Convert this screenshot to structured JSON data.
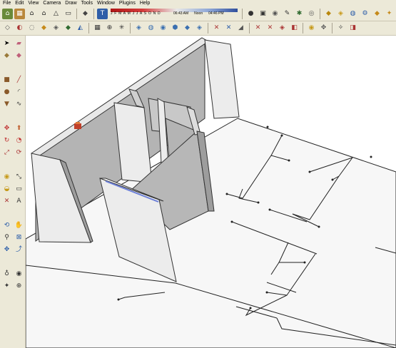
{
  "menu": [
    "File",
    "Edit",
    "View",
    "Camera",
    "Draw",
    "Tools",
    "Window",
    "Plugins",
    "Help"
  ],
  "shadow_settings": {
    "months": "J F M A M J J A S O N D",
    "time_start": "06:43 AM",
    "time_noon": "Noon",
    "time_end": "04:46 PM"
  },
  "icons": {
    "row1_a": [
      "footprint-icon",
      "components-icon",
      "home-icon",
      "house-icon",
      "house-outline-icon",
      "scene-icon"
    ],
    "row1_b": [
      "styles-icon",
      "text-icon"
    ],
    "row1_c": [
      "cup-icon",
      "warehouse-icon",
      "sphere-icon",
      "pen-icon",
      "bug-icon",
      "layers-icon"
    ],
    "row1_d": [
      "rocket-icon",
      "cube-icon",
      "globe-icon",
      "gear-icon",
      "tag-icon",
      "sparkle-icon"
    ],
    "row2": [
      "box-icon",
      "push-pull-icon",
      "follow-icon",
      "paint-icon",
      "explode-icon",
      "sandbox-icon",
      "section-icon",
      "grid-icon",
      "crosshair-icon",
      "sun-icon",
      "iso-view-icon",
      "top-view-icon",
      "front-view-icon",
      "right-view-icon",
      "back-view-icon",
      "left-view-icon",
      "xray-icon",
      "back-edges-icon",
      "wire-icon",
      "hidden-line-icon",
      "shaded-icon",
      "textured-icon",
      "mono-icon",
      "camera-icon",
      "look-icon",
      "walk-icon",
      "position-icon"
    ],
    "left": [
      "select-tool-icon",
      "eraser-tool-icon",
      "component-tool-icon",
      "paint-bucket-icon",
      "rectangle-tool-icon",
      "line-tool-icon",
      "circle-tool-icon",
      "arc-tool-icon",
      "polygon-tool-icon",
      "freehand-tool-icon",
      "move-tool-icon",
      "push-pull-tool-icon",
      "rotate-tool-icon",
      "follow-me-tool-icon",
      "scale-tool-icon",
      "offset-tool-icon",
      "tape-measure-icon",
      "dimension-tool-icon",
      "protractor-icon",
      "text-tool-icon",
      "axes-tool-icon",
      "3d-text-icon",
      "orbit-tool-icon",
      "pan-tool-icon",
      "zoom-tool-icon",
      "zoom-window-icon",
      "zoom-extents-icon",
      "previous-view-icon",
      "position-camera-icon",
      "look-around-icon",
      "walk-tool-icon",
      "section-plane-icon"
    ]
  },
  "colors": {
    "toolbar_bg": "#ece9d8",
    "canvas_bg": "#ffffff",
    "wall_shadow": "#b4b4b4",
    "wall_light": "#ececec"
  }
}
